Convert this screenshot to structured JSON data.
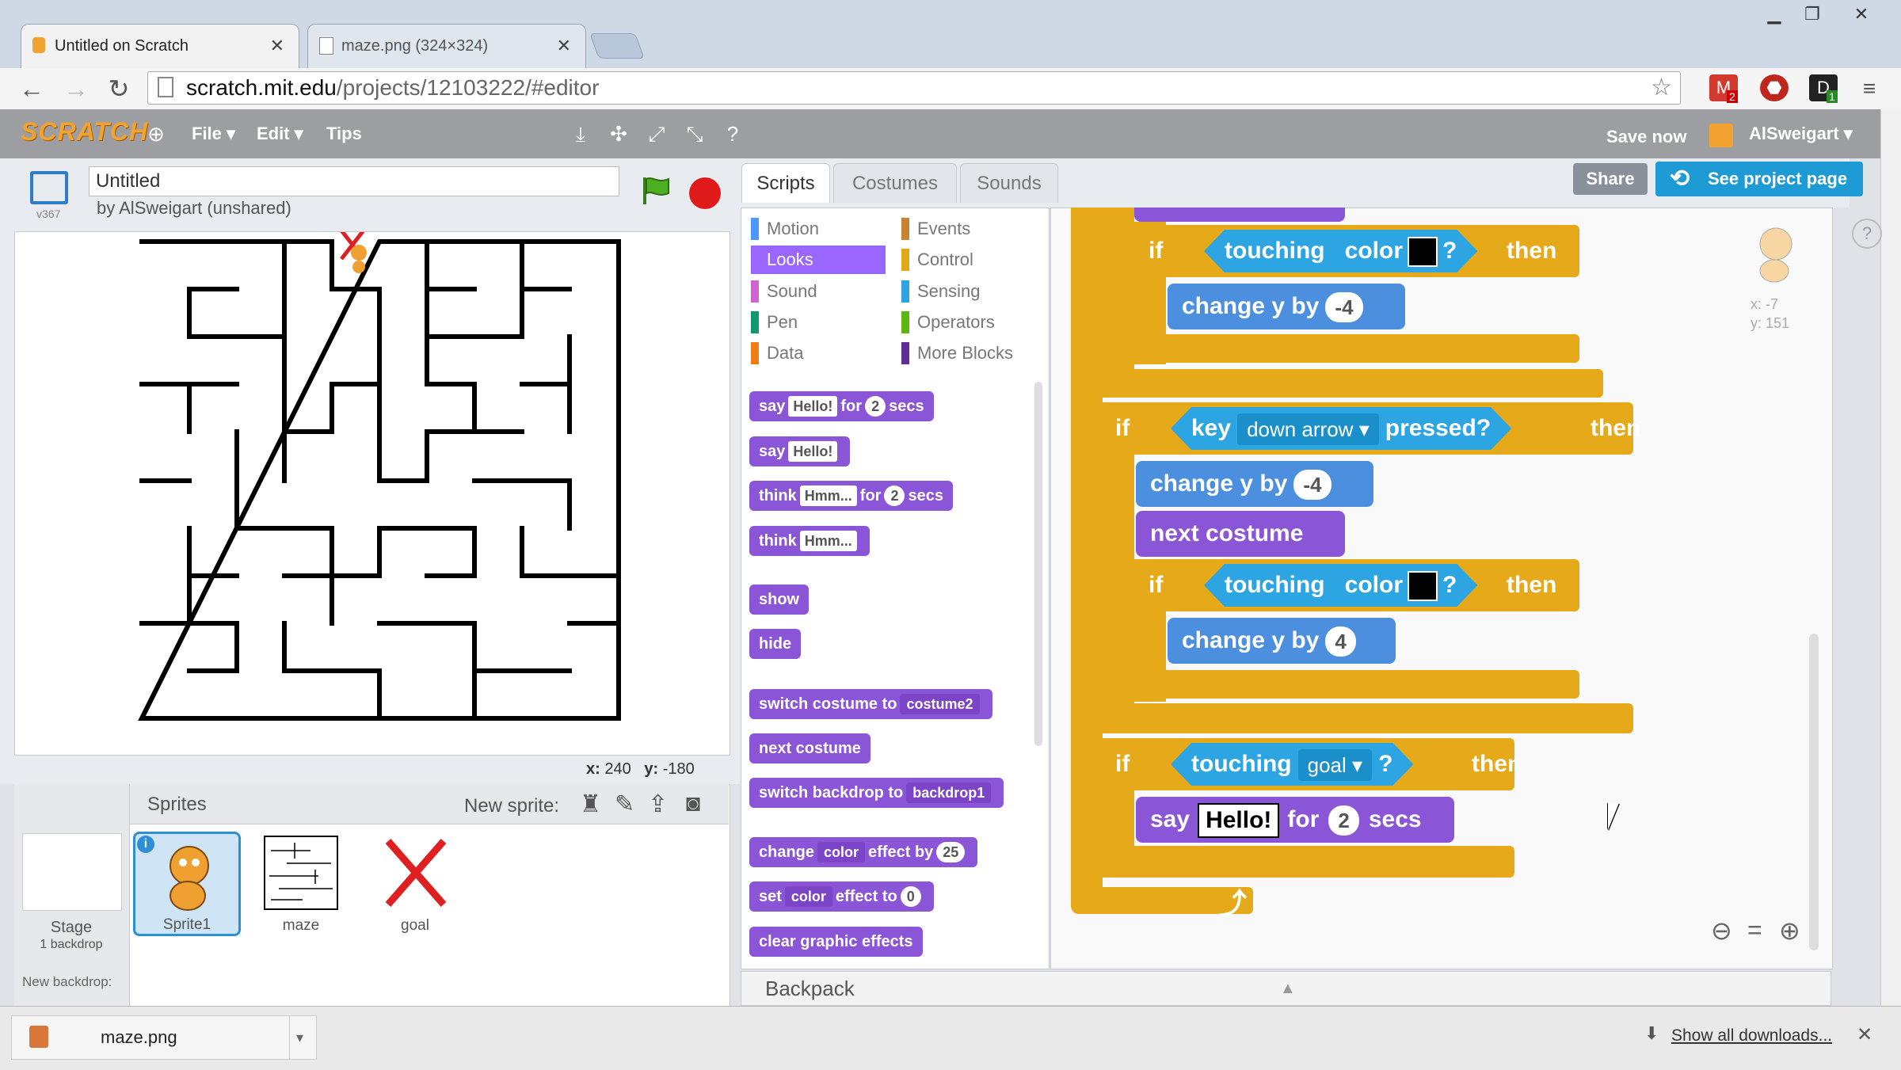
{
  "browser": {
    "tabs": [
      {
        "title": "Untitled on Scratch"
      },
      {
        "title": "maze.png (324×324)"
      }
    ],
    "url_host": "scratch.mit.edu",
    "url_path": "/projects/12103222/#editor",
    "extension_badges": [
      "2",
      "1"
    ]
  },
  "menubar": {
    "logo": "SCRATCH",
    "file": "File ▾",
    "edit": "Edit ▾",
    "tips": "Tips",
    "save_now": "Save now",
    "user": "AlSweigart ▾"
  },
  "project": {
    "title": "Untitled",
    "byline": "by AlSweigart (unshared)",
    "version": "v367"
  },
  "stage": {
    "x_label": "x:",
    "x_value": "240",
    "y_label": "y:",
    "y_value": "-180"
  },
  "sprites": {
    "header": "Sprites",
    "new_sprite": "New sprite:",
    "stage_label": "Stage",
    "stage_backdrops": "1 backdrop",
    "new_backdrop": "New backdrop:",
    "items": [
      {
        "name": "Sprite1"
      },
      {
        "name": "maze"
      },
      {
        "name": "goal"
      }
    ]
  },
  "editor": {
    "tabs": [
      "Scripts",
      "Costumes",
      "Sounds"
    ],
    "share": "Share",
    "see_project_page": "See project page",
    "sprite_x": "x: -7",
    "sprite_y": "y: 151",
    "backpack": "Backpack"
  },
  "categories": [
    {
      "name": "Motion",
      "color": "#4c97ff"
    },
    {
      "name": "Events",
      "color": "#c88330"
    },
    {
      "name": "Looks",
      "color": "#9966ff"
    },
    {
      "name": "Control",
      "color": "#e1a91a"
    },
    {
      "name": "Sound",
      "color": "#cf63cf"
    },
    {
      "name": "Sensing",
      "color": "#2ca5e2"
    },
    {
      "name": "Pen",
      "color": "#0e9a6c"
    },
    {
      "name": "Operators",
      "color": "#5cb712"
    },
    {
      "name": "Data",
      "color": "#ee7d16"
    },
    {
      "name": "More Blocks",
      "color": "#632d99"
    }
  ],
  "palette": {
    "say_for": {
      "say": "say",
      "msg": "Hello!",
      "for": "for",
      "n": "2",
      "secs": "secs"
    },
    "say": {
      "say": "say",
      "msg": "Hello!"
    },
    "think_for": {
      "think": "think",
      "msg": "Hmm...",
      "for": "for",
      "n": "2",
      "secs": "secs"
    },
    "think": {
      "think": "think",
      "msg": "Hmm..."
    },
    "show": "show",
    "hide": "hide",
    "switch_costume": {
      "label": "switch costume to",
      "value": "costume2"
    },
    "next_costume": "next costume",
    "switch_backdrop": {
      "label": "switch backdrop to",
      "value": "backdrop1"
    },
    "change_effect": {
      "change": "change",
      "effect": "color",
      "by": "effect by",
      "n": "25"
    },
    "set_effect": {
      "set": "set",
      "effect": "color",
      "to": "effect to",
      "n": "0"
    },
    "clear_effects": "clear graphic effects"
  },
  "script": {
    "if": "if",
    "then": "then",
    "touching": "touching",
    "color": "color",
    "q": "?",
    "change_y_by": "change y by",
    "val_neg4a": "-4",
    "key": "key",
    "key_value": "down arrow",
    "pressed": "pressed?",
    "val_neg4b": "-4",
    "next_costume": "next costume",
    "val_4": "4",
    "goal": "goal",
    "say": "say",
    "hello": "Hello!",
    "for": "for",
    "secs_n": "2",
    "secs": "secs"
  },
  "download": {
    "file": "maze.png",
    "show_all": "Show all downloads..."
  }
}
